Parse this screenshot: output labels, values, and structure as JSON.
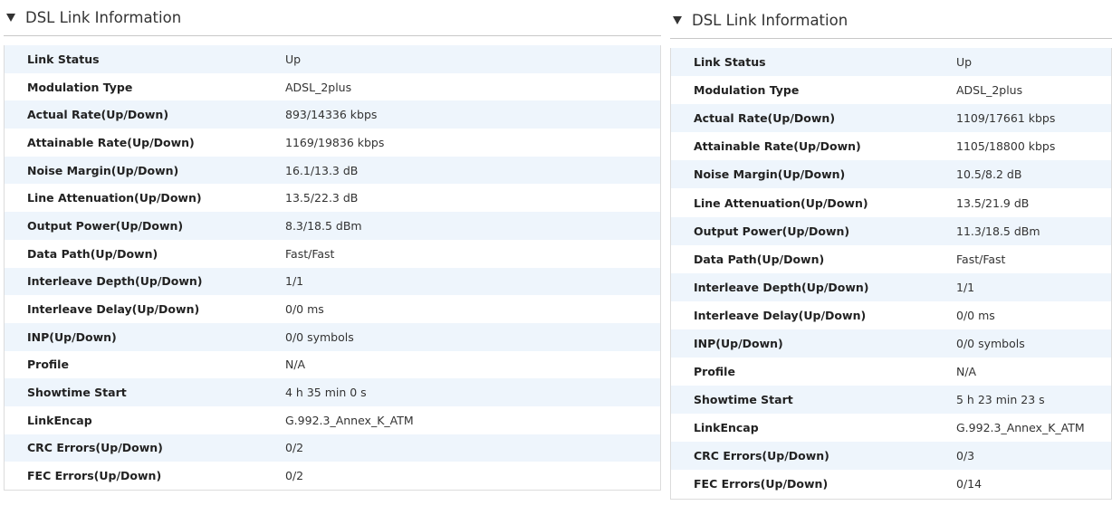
{
  "panels": [
    {
      "title": "DSL Link Information",
      "rows": [
        {
          "label": "Link Status",
          "value": "Up"
        },
        {
          "label": "Modulation Type",
          "value": "ADSL_2plus"
        },
        {
          "label": "Actual Rate(Up/Down)",
          "value": "893/14336 kbps"
        },
        {
          "label": "Attainable Rate(Up/Down)",
          "value": "1169/19836 kbps"
        },
        {
          "label": "Noise Margin(Up/Down)",
          "value": "16.1/13.3 dB"
        },
        {
          "label": "Line Attenuation(Up/Down)",
          "value": "13.5/22.3 dB"
        },
        {
          "label": "Output Power(Up/Down)",
          "value": "8.3/18.5 dBm"
        },
        {
          "label": "Data Path(Up/Down)",
          "value": "Fast/Fast"
        },
        {
          "label": "Interleave Depth(Up/Down)",
          "value": "1/1"
        },
        {
          "label": "Interleave Delay(Up/Down)",
          "value": "0/0 ms"
        },
        {
          "label": "INP(Up/Down)",
          "value": "0/0 symbols"
        },
        {
          "label": "Profile",
          "value": "N/A"
        },
        {
          "label": "Showtime Start",
          "value": "4 h 35 min 0 s"
        },
        {
          "label": "LinkEncap",
          "value": "G.992.3_Annex_K_ATM"
        },
        {
          "label": "CRC Errors(Up/Down)",
          "value": "0/2"
        },
        {
          "label": "FEC Errors(Up/Down)",
          "value": "0/2"
        }
      ]
    },
    {
      "title": "DSL Link Information",
      "rows": [
        {
          "label": "Link Status",
          "value": "Up"
        },
        {
          "label": "Modulation Type",
          "value": "ADSL_2plus"
        },
        {
          "label": "Actual Rate(Up/Down)",
          "value": "1109/17661 kbps"
        },
        {
          "label": "Attainable Rate(Up/Down)",
          "value": "1105/18800 kbps"
        },
        {
          "label": "Noise Margin(Up/Down)",
          "value": "10.5/8.2 dB"
        },
        {
          "label": "Line Attenuation(Up/Down)",
          "value": "13.5/21.9 dB"
        },
        {
          "label": "Output Power(Up/Down)",
          "value": "11.3/18.5 dBm"
        },
        {
          "label": "Data Path(Up/Down)",
          "value": "Fast/Fast"
        },
        {
          "label": "Interleave Depth(Up/Down)",
          "value": "1/1"
        },
        {
          "label": "Interleave Delay(Up/Down)",
          "value": "0/0 ms"
        },
        {
          "label": "INP(Up/Down)",
          "value": "0/0 symbols"
        },
        {
          "label": "Profile",
          "value": "N/A"
        },
        {
          "label": "Showtime Start",
          "value": "5 h 23 min 23 s"
        },
        {
          "label": "LinkEncap",
          "value": "G.992.3_Annex_K_ATM"
        },
        {
          "label": "CRC Errors(Up/Down)",
          "value": "0/3"
        },
        {
          "label": "FEC Errors(Up/Down)",
          "value": "0/14"
        }
      ]
    }
  ]
}
